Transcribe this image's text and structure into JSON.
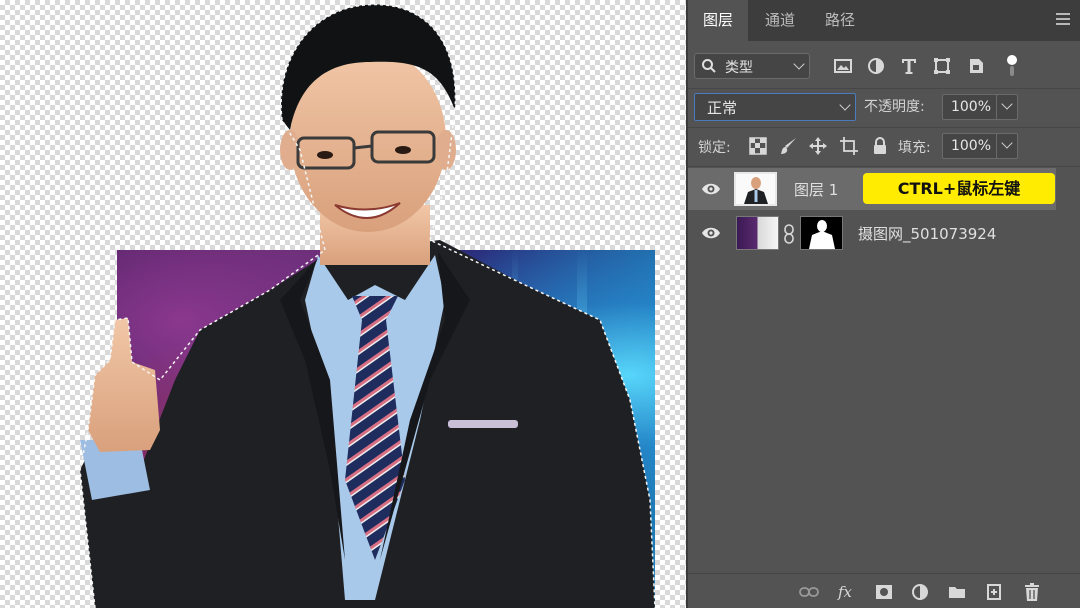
{
  "panel": {
    "tabs": [
      {
        "label": "图层",
        "active": true
      },
      {
        "label": "通道",
        "active": false
      },
      {
        "label": "路径",
        "active": false
      }
    ],
    "filter": {
      "label": "类型"
    },
    "blend_mode": "正常",
    "opacity_label": "不透明度:",
    "opacity_value": "100%",
    "lock_label": "锁定:",
    "fill_label": "填充:",
    "fill_value": "100%",
    "layers": [
      {
        "name": "图层 1",
        "visible": true,
        "selected": true
      },
      {
        "name": "摄图网_501073924",
        "visible": true,
        "selected": false,
        "has_mask": true
      }
    ]
  },
  "annotation": {
    "text": "CTRL+鼠标左键",
    "color": "#ffec00"
  },
  "colors": {
    "panel_bg": "#535353",
    "tab_bg": "#3d3d3d",
    "selected_row": "#6b6b6b",
    "accent_border": "#4a7bbd"
  }
}
